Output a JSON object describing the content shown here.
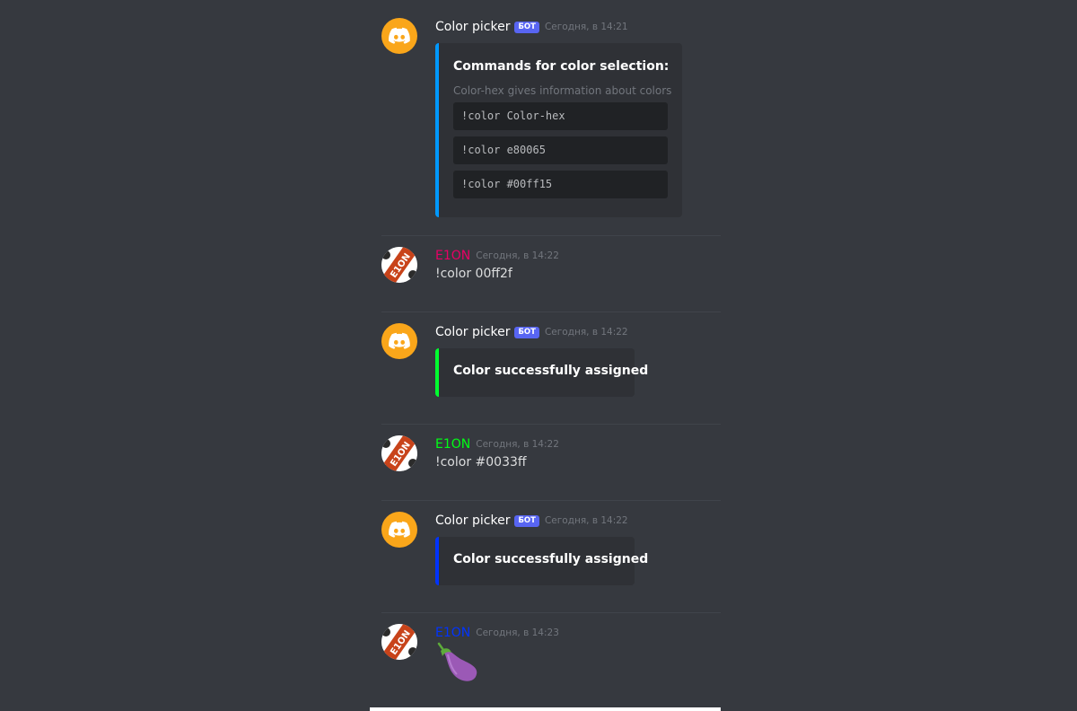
{
  "colors": {
    "background": "#36393f",
    "bot_avatar": "#faa61a",
    "bot_badge": "#5865f2",
    "embed_blue": "#0099ff",
    "embed_green": "#00ff2f",
    "embed_darkblue": "#0033ff",
    "user_magenta": "#e80065",
    "user_green": "#00ff15",
    "user_blue": "#0033ff"
  },
  "messages": [
    {
      "author": "Color picker",
      "badge": "БОТ",
      "timestamp": "Сегодня, в 14:21",
      "avatar_icon": "discord-logo-icon",
      "embed": {
        "accent": "#0099ff",
        "title": "Commands for color selection:",
        "description": "Color-hex gives information about colors",
        "code_blocks": [
          "!color Color-hex",
          "!color e80065",
          "!color #00ff15"
        ]
      }
    },
    {
      "author": "E1ON",
      "author_color": "#e80065",
      "timestamp": "Сегодня, в 14:22",
      "avatar_icon": "e1on-avatar-icon",
      "text": "!color 00ff2f"
    },
    {
      "author": "Color picker",
      "badge": "БОТ",
      "timestamp": "Сегодня, в 14:22",
      "avatar_icon": "discord-logo-icon",
      "embed": {
        "accent": "#00ff2f",
        "title": "Color successfully assigned"
      }
    },
    {
      "author": "E1ON",
      "author_color": "#00ff15",
      "timestamp": "Сегодня, в 14:22",
      "avatar_icon": "e1on-avatar-icon",
      "text": "!color #0033ff"
    },
    {
      "author": "Color picker",
      "badge": "БОТ",
      "timestamp": "Сегодня, в 14:22",
      "avatar_icon": "discord-logo-icon",
      "embed": {
        "accent": "#0033ff",
        "title": "Color successfully assigned"
      }
    },
    {
      "author": "E1ON",
      "author_color": "#0033ff",
      "timestamp": "Сегодня, в 14:23",
      "avatar_icon": "e1on-avatar-icon",
      "emoji": "eggplant-emoji-icon"
    }
  ]
}
